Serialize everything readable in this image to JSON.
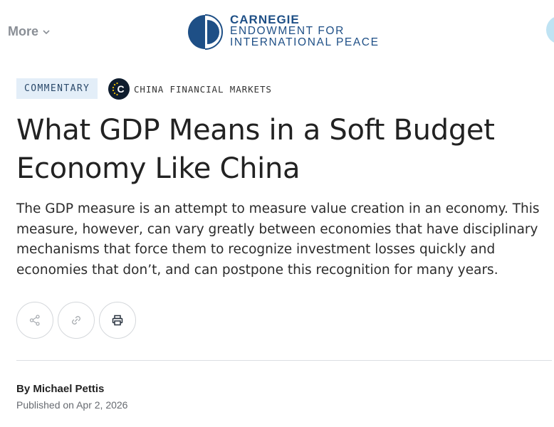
{
  "header": {
    "more_label": "More",
    "logo": {
      "line1": "CARNEGIE",
      "line2": "ENDOWMENT FOR",
      "line3": "INTERNATIONAL PEACE"
    }
  },
  "article": {
    "type_tag": "COMMENTARY",
    "program_label": "CHINA FINANCIAL MARKETS",
    "program_badge_letter": "C",
    "title": "What GDP Means in a Soft Budget Economy Like China",
    "dek": "The GDP measure is an attempt to measure value creation in an economy. This measure, however, can vary greatly between economies that have disciplinary mechanisms that force them to recognize investment losses quickly and economies that don’t, and can postpone this recognition for many years.",
    "byline_prefix": "By ",
    "author": "Michael Pettis",
    "published_prefix": "Published on ",
    "published_date": "Apr 2, 2026"
  },
  "actions": [
    {
      "icon": "share-icon"
    },
    {
      "icon": "link-icon"
    },
    {
      "icon": "print-icon"
    }
  ],
  "colors": {
    "brand": "#1e4f86",
    "tag_bg": "#e3eef8",
    "badge_bg": "#0f1d2e",
    "badge_star": "#f2c200",
    "muted": "#8a8f96"
  }
}
